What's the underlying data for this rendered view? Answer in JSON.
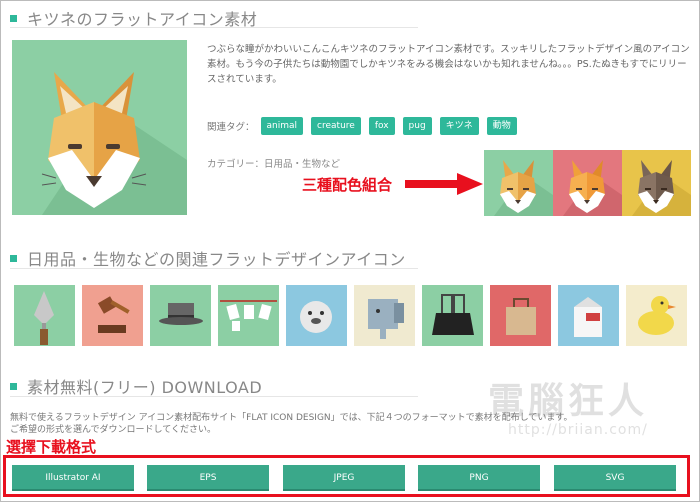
{
  "section1": {
    "title": "キツネのフラットアイコン素材",
    "description": "つぶらな瞳がかわいいこんこんキツネのフラットアイコン素材です。スッキリしたフラットデザイン風のアイコン素材。もう今の子供たちは動物園でしかキツネをみる機会はないかも知れませんね。。。PS.たぬきもすでにリリースされています。",
    "tags_label": "関連タグ：",
    "tags": [
      "animal",
      "creature",
      "fox",
      "pug",
      "キツネ",
      "動物"
    ],
    "category": "カテゴリー：日用品・生物など",
    "annotation": "三種配色組合"
  },
  "section2": {
    "title": "日用品・生物などの関連フラットデザインアイコン",
    "icons": [
      "trowel-icon",
      "gavel-icon",
      "hat-icon",
      "clothesline-icon",
      "seal-icon",
      "elephant-icon",
      "binder-clip-icon",
      "shopping-bag-icon",
      "milk-carton-icon",
      "duck-icon"
    ]
  },
  "section3": {
    "title": "素材無料(フリー) DOWNLOAD",
    "description_line1": "無料で使えるフラットデザイン アイコン素材配布サイト「FLAT ICON DESIGN」では、下記４つのフォーマットで素材を配布しています。",
    "description_line2": "ご希望の形式を選んでダウンロードしてください。",
    "annotation": "選擇下載格式",
    "buttons": [
      "Illustrator AI",
      "EPS",
      "JPEG",
      "PNG",
      "SVG"
    ]
  },
  "watermark": {
    "text": "電腦狂人",
    "url": "http://briian.com/"
  },
  "colors": {
    "accent": "#2eb89a",
    "annotation_red": "#e8101e",
    "hero_bg": "#8ccfa4",
    "variant_green": "#8ccfa4",
    "variant_red": "#e3777e",
    "variant_yellow": "#e8c44a",
    "button": "#3aa88a"
  }
}
